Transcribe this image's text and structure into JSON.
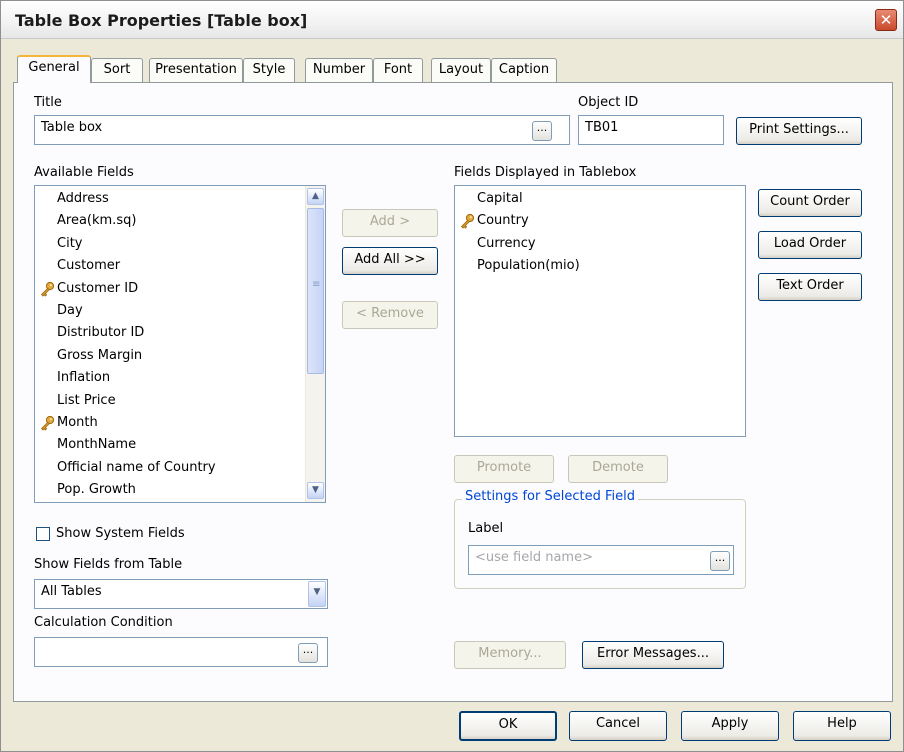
{
  "window": {
    "title": "Table Box Properties [Table box]",
    "close_glyph": "✕"
  },
  "tabs": [
    {
      "label": "General",
      "active": true
    },
    {
      "label": "Sort"
    },
    {
      "label": "Presentation"
    },
    {
      "label": "Style"
    },
    {
      "label": "Number"
    },
    {
      "label": "Font"
    },
    {
      "label": "Layout"
    },
    {
      "label": "Caption"
    }
  ],
  "general": {
    "title_label": "Title",
    "title_value": "Table box",
    "object_id_label": "Object ID",
    "object_id_value": "TB01",
    "print_settings_label": "Print Settings...",
    "available_fields_label": "Available Fields",
    "available_fields": [
      {
        "label": "Address",
        "key": false
      },
      {
        "label": "Area(km.sq)",
        "key": false
      },
      {
        "label": "City",
        "key": false
      },
      {
        "label": "Customer",
        "key": false
      },
      {
        "label": "Customer ID",
        "key": true
      },
      {
        "label": "Day",
        "key": false
      },
      {
        "label": "Distributor ID",
        "key": false
      },
      {
        "label": "Gross Margin",
        "key": false
      },
      {
        "label": "Inflation",
        "key": false
      },
      {
        "label": "List Price",
        "key": false
      },
      {
        "label": "Month",
        "key": true
      },
      {
        "label": "MonthName",
        "key": false
      },
      {
        "label": "Official name of Country",
        "key": false
      },
      {
        "label": "Pop. Growth",
        "key": false
      }
    ],
    "add_label": "Add >",
    "add_all_label": "Add All >>",
    "remove_label": "< Remove",
    "displayed_fields_label": "Fields Displayed in Tablebox",
    "displayed_fields": [
      {
        "label": "Capital",
        "key": false
      },
      {
        "label": "Country",
        "key": true
      },
      {
        "label": "Currency",
        "key": false
      },
      {
        "label": "Population(mio)",
        "key": false
      }
    ],
    "count_order_label": "Count Order",
    "load_order_label": "Load Order",
    "text_order_label": "Text Order",
    "promote_label": "Promote",
    "demote_label": "Demote",
    "settings_group_label": "Settings for Selected Field",
    "label_label": "Label",
    "label_placeholder": "<use field name>",
    "show_system_fields_label": "Show System Fields",
    "show_system_fields_checked": false,
    "show_fields_from_table_label": "Show Fields from Table",
    "show_fields_from_table_value": "All Tables",
    "calculation_condition_label": "Calculation Condition",
    "calculation_condition_value": "",
    "memory_label": "Memory...",
    "error_messages_label": "Error Messages..."
  },
  "footer": {
    "ok_label": "OK",
    "cancel_label": "Cancel",
    "apply_label": "Apply",
    "help_label": "Help"
  },
  "icons": {
    "dots": "...",
    "scroll_up": "▲",
    "scroll_down": "▼",
    "dropdown": "▼",
    "grip": "≡"
  },
  "colors": {
    "dialog_bg": "#ece9d8",
    "panel_bg": "#fcfcfe",
    "input_border": "#7f9db9",
    "group_legend": "#0046d5",
    "tab_highlight": "#f5b43a"
  }
}
